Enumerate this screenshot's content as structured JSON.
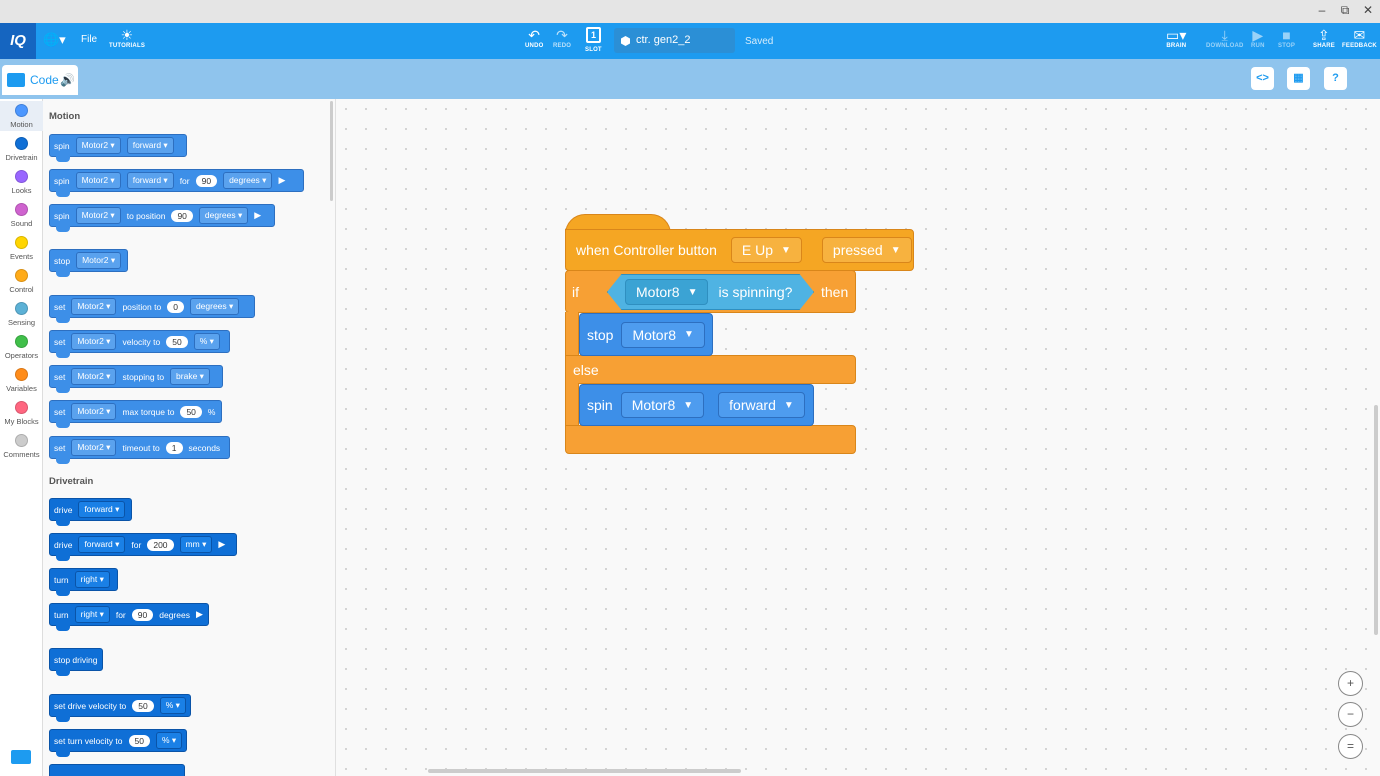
{
  "window": {
    "minimize": "–",
    "restore": "⧉",
    "close": "✕"
  },
  "toolbar": {
    "logo": "IQ",
    "file": "File",
    "tutorials": "TUTORIALS",
    "undo": "UNDO",
    "redo": "REDO",
    "slot": "SLOT",
    "slot_number": "1",
    "project_name": "ctr. gen2_2",
    "status": "Saved",
    "brain": "BRAIN",
    "download": "DOWNLOAD",
    "run": "RUN",
    "stop": "STOP",
    "share": "SHARE",
    "feedback": "FEEDBACK"
  },
  "subbar": {
    "code_tab": "Code"
  },
  "categories": [
    {
      "label": "Motion",
      "color": "#4c97ff"
    },
    {
      "label": "Drivetrain",
      "color": "#0f6fd6"
    },
    {
      "label": "Looks",
      "color": "#9966ff"
    },
    {
      "label": "Sound",
      "color": "#cf63cf"
    },
    {
      "label": "Events",
      "color": "#ffd500"
    },
    {
      "label": "Control",
      "color": "#ffab19"
    },
    {
      "label": "Sensing",
      "color": "#5cb1d6"
    },
    {
      "label": "Operators",
      "color": "#40bf4a"
    },
    {
      "label": "Variables",
      "color": "#ff8c1a"
    },
    {
      "label": "My Blocks",
      "color": "#ff6680"
    },
    {
      "label": "Comments",
      "color": "#cccccc"
    }
  ],
  "palette": {
    "motion_title": "Motion",
    "drivetrain_title": "Drivetrain",
    "motor": "Motor2",
    "spin": "spin",
    "forward": "forward",
    "for": "for",
    "degrees": "degrees",
    "to_position": "to position",
    "stop": "stop",
    "set": "set",
    "position_to": "position to",
    "velocity_to": "velocity to",
    "percent": "%",
    "stopping_to": "stopping to",
    "brake": "brake",
    "max_torque_to": "max torque to",
    "timeout_to": "timeout to",
    "seconds": "seconds",
    "v90": "90",
    "v0": "0",
    "v50": "50",
    "v1": "1",
    "v200": "200",
    "drive": "drive",
    "mm": "mm",
    "turn": "turn",
    "right": "right",
    "stop_driving": "stop driving",
    "set_drive_velocity": "set drive velocity to",
    "set_turn_velocity": "set turn velocity to"
  },
  "script": {
    "hat_text": "when Controller button",
    "button": "E Up",
    "action": "pressed",
    "if": "if",
    "condition_motor": "Motor8",
    "condition_text": "is spinning?",
    "then": "then",
    "stop": "stop",
    "stop_motor": "Motor8",
    "else": "else",
    "spin": "spin",
    "spin_motor": "Motor8",
    "direction": "forward"
  },
  "zoom": {
    "in": "+",
    "out": "−",
    "reset": "="
  }
}
